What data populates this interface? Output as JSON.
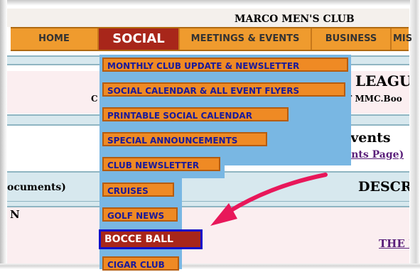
{
  "club_title": "MARCO MEN'S CLUB",
  "nav": [
    {
      "label": "HOME"
    },
    {
      "label": "SOCIAL"
    },
    {
      "label": "MEETINGS & EVENTS"
    },
    {
      "label": "BUSINESS"
    },
    {
      "label": "MIS"
    }
  ],
  "background": {
    "league": "LEAGU",
    "contact_prefix": "C",
    "contact_suffix": "JOHNSON AT  MMC.Boo",
    "coming_events": "d Coming Events",
    "coming_link": "so see the Coming Events Page)",
    "documents": "ocuments)",
    "descr": "DESCR",
    "n_letter": "N",
    "the_k": "THE K"
  },
  "dropdown": [
    {
      "label": "MONTHLY CLUB  UPDATE & NEWSLETTER"
    },
    {
      "label": "SOCIAL CALENDAR & ALL EVENT FLYERS"
    },
    {
      "label": "PRINTABLE SOCIAL CALENDAR"
    },
    {
      "label": "SPECIAL ANNOUNCEMENTS"
    },
    {
      "label": "CLUB NEWSLETTER"
    },
    {
      "label": "CRUISES"
    },
    {
      "label": "GOLF NEWS"
    },
    {
      "label": "BOCCE BALL"
    },
    {
      "label": "CIGAR CLUB"
    }
  ],
  "colors": {
    "nav_bg": "#ef9b2e",
    "nav_active": "#a8261a",
    "dropdown_bg": "#79b7e3",
    "dropdown_item": "#ef8a24",
    "highlight_border": "#1010c8",
    "arrow": "#e8175a"
  }
}
